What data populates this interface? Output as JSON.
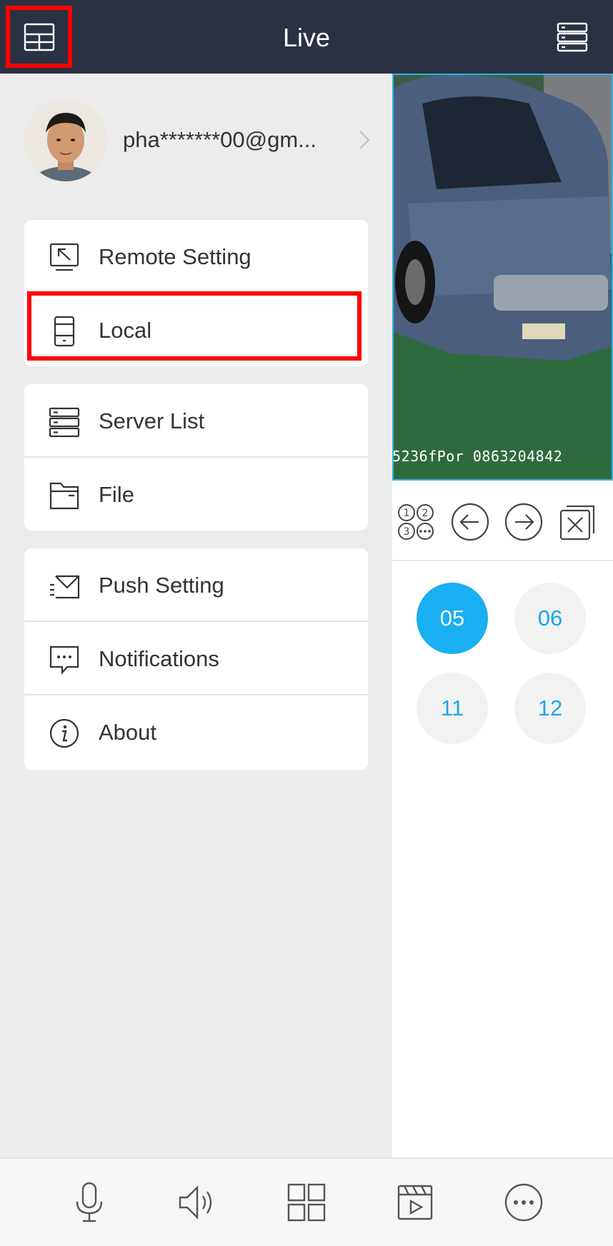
{
  "header": {
    "title": "Live"
  },
  "profile": {
    "email": "pha*******00@gm..."
  },
  "menu": {
    "group1": [
      {
        "label": "Remote Setting",
        "icon": "remote-setting-icon"
      },
      {
        "label": "Local",
        "icon": "phone-icon",
        "highlighted": true
      }
    ],
    "group2": [
      {
        "label": "Server List",
        "icon": "server-list-icon"
      },
      {
        "label": "File",
        "icon": "folder-icon"
      }
    ],
    "group3": [
      {
        "label": "Push Setting",
        "icon": "push-message-icon"
      },
      {
        "label": "Notifications",
        "icon": "chat-bubble-icon"
      },
      {
        "label": "About",
        "icon": "info-icon"
      }
    ]
  },
  "live": {
    "osd_text": "5236fPor 0863204842",
    "channels": [
      {
        "label": "05",
        "active": true
      },
      {
        "label": "06",
        "active": false
      },
      {
        "label": "11",
        "active": false
      },
      {
        "label": "12",
        "active": false
      }
    ]
  },
  "colors": {
    "header_bg": "#2a3142",
    "accent": "#1aaef2",
    "highlight_border": "#ff0000",
    "drawer_bg": "#ececec"
  }
}
